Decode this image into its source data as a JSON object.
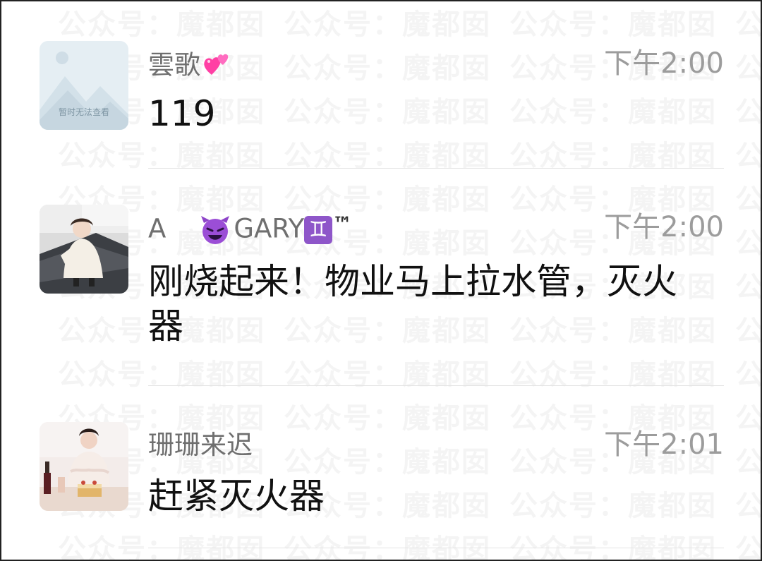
{
  "watermark": {
    "text": "公众号：魔都囡"
  },
  "messages": [
    {
      "name": "雲歌",
      "name_emoji": "heart-icon",
      "time": "下午2:00",
      "text": "119",
      "avatar": {
        "kind": "placeholder",
        "caption": "暂时无法查看"
      }
    },
    {
      "name_prefix": "A",
      "name_main": "GARY",
      "name_suffix": "™",
      "name_icons": [
        "devil-emoji-icon",
        "gemini-sign-icon"
      ],
      "gemini_glyph": "♊",
      "time": "下午2:00",
      "text": "刚烧起来！物业马上拉水管，灭火器",
      "avatar": {
        "kind": "photo",
        "subject": "child-in-white-dress"
      }
    },
    {
      "name": "珊珊来迟",
      "time": "下午2:01",
      "text": "赶紧灭火器",
      "avatar": {
        "kind": "photo",
        "subject": "woman-with-cake"
      }
    }
  ],
  "colors": {
    "name": "#6f6f6f",
    "time": "#9c9c9c",
    "text": "#111111",
    "divider": "#e4e4e4",
    "gemini": "#8e56c9",
    "devil": "#8e44c9",
    "heart": "#ff3fa4"
  }
}
